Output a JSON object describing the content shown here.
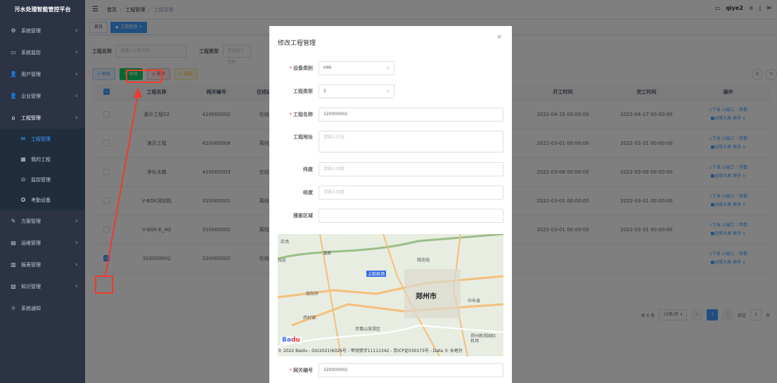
{
  "app": {
    "title": "污水处理智能管控平台"
  },
  "sidebar": {
    "items": [
      {
        "label": "系统管理",
        "icon": "gear-icon",
        "glyph": "⚙"
      },
      {
        "label": "系统监控",
        "icon": "monitor-icon",
        "glyph": "▭"
      },
      {
        "label": "用户管理",
        "icon": "user-icon",
        "glyph": "👤"
      },
      {
        "label": "企业管理",
        "icon": "company-icon",
        "glyph": "👤"
      },
      {
        "label": "工程管理",
        "icon": "engineering-icon",
        "glyph": "⌂"
      },
      {
        "label": "工程管理",
        "icon": "project-icon",
        "glyph": "✉"
      },
      {
        "label": "我的工程",
        "icon": "my-project-icon",
        "glyph": "▦"
      },
      {
        "label": "监控管理",
        "icon": "watch-icon",
        "glyph": "⊙"
      },
      {
        "label": "考勤设备",
        "icon": "device-icon",
        "glyph": "✪"
      },
      {
        "label": "方案管理",
        "icon": "plan-icon",
        "glyph": "✎"
      },
      {
        "label": "运维管理",
        "icon": "ops-icon",
        "glyph": "▤"
      },
      {
        "label": "报表管理",
        "icon": "report-icon",
        "glyph": "▥"
      },
      {
        "label": "知识管理",
        "icon": "knowledge-icon",
        "glyph": "▧"
      },
      {
        "label": "系统通知",
        "icon": "notice-icon",
        "glyph": "☼"
      }
    ]
  },
  "breadcrumb": [
    "首页",
    "工程管理",
    "工程管理"
  ],
  "topbar": {
    "user": "qiye2"
  },
  "tags": [
    "首页",
    "工程管理"
  ],
  "filter": {
    "name_label": "工程名称",
    "name_placeholder": "请输入工程名称",
    "type_label": "工程类型",
    "type_placeholder": "请选择工程类"
  },
  "toolbar": {
    "add": "+ 新增",
    "edit": "✎ 修改",
    "del": "⊖ 删除",
    "export": "⇩ 导出"
  },
  "table": {
    "headers": [
      "",
      "工程名称",
      "网关编号",
      "在线状",
      "",
      "",
      "价",
      "开工时间",
      "完工时间",
      "操作"
    ],
    "rows": [
      {
        "name": "演示工程02",
        "gw": "410000002",
        "state": "在线",
        "num": "",
        "start": "2022-04-15 00:00:00",
        "end": "2022-04-17 00:00:00",
        "checked": false
      },
      {
        "name": "演示工程",
        "gw": "410000008",
        "state": "离线",
        "num": "",
        "start": "2022-03-01 00:00:00",
        "end": "2022-03-31 00:00:00",
        "checked": false
      },
      {
        "name": "净化水箱",
        "gw": "410000003",
        "state": "在线",
        "num": "",
        "start": "2022-03-08 00:00:00",
        "end": "2022-03-09 00:00:00",
        "checked": false
      },
      {
        "name": "V-BOX测试机",
        "gw": "310000001",
        "state": "离线",
        "num": "",
        "start": "2022-03-01 00:00:00",
        "end": "2022-03-31 00:00:00",
        "checked": false
      },
      {
        "name": "V-BOX-E_4G",
        "gw": "310000002",
        "state": "离线",
        "num": "1",
        "start": "2022-03-01 00:00:00",
        "end": "2022-03-31 00:00:00",
        "checked": false
      },
      {
        "name": "320000002",
        "gw": "320000002",
        "state": "在线",
        "num": "",
        "start": "",
        "end": "",
        "checked": true
      }
    ],
    "ops_line1": "↓下发 ⊙端口 ♡参数",
    "ops_line2": "■运维大屏 更多 ∨"
  },
  "pager": {
    "total": "共 6 条",
    "size": "10条/页",
    "page": "1",
    "goto": "前往",
    "goto_val": "1",
    "page_unit": "页"
  },
  "modal": {
    "title": "修改工程管理",
    "fields": {
      "device_type": {
        "label": "设备类别",
        "value": "HMI"
      },
      "project_type": {
        "label": "工程类型",
        "value": "2"
      },
      "project_name": {
        "label": "工程名称",
        "value": "320000002"
      },
      "address": {
        "label": "工程地址",
        "placeholder": "请输入内容"
      },
      "lat": {
        "label": "纬度",
        "placeholder": "请输入纬度"
      },
      "lng": {
        "label": "经度",
        "placeholder": "请输入经度"
      },
      "search": {
        "label": "搜索区域",
        "value": ""
      },
      "gateway": {
        "label": "网关编号",
        "value": "320000002"
      }
    },
    "map": {
      "labels": [
        "农场",
        "温县",
        "桃花峪",
        "上街机场",
        "荥阳市",
        "郑州市",
        "中牟县",
        "西村镇",
        "伏羲山旅游区",
        "郑州新郑国际机场",
        "州市"
      ],
      "copyright": "© 2022 Baidu - GS(2021)6026号 - 甲测资字11111342 - 京ICP证030173号 - Data © 长地万"
    }
  }
}
